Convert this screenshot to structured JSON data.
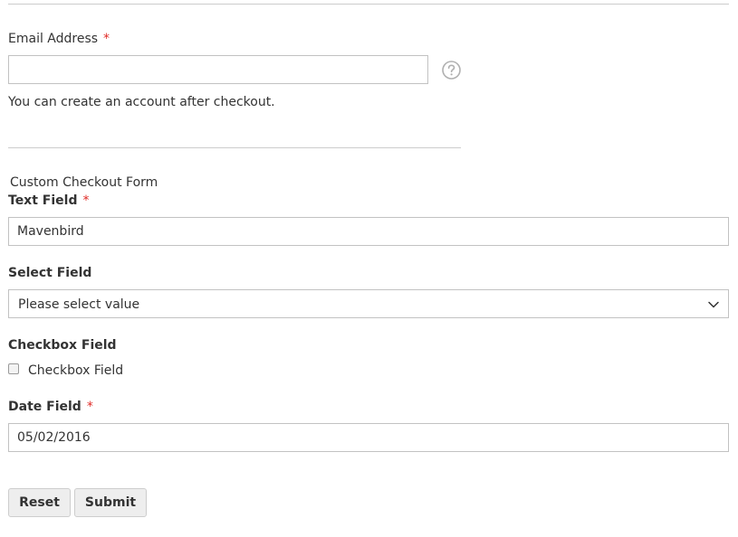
{
  "email": {
    "label": "Email Address",
    "required_mark": "*",
    "value": "",
    "help_icon": "question-circle-icon",
    "note": "You can create an account after checkout."
  },
  "custom_form": {
    "legend": "Custom Checkout Form",
    "text_field": {
      "label": "Text Field",
      "required_mark": "*",
      "value": "Mavenbird"
    },
    "select_field": {
      "label": "Select Field",
      "selected": "Please select value"
    },
    "checkbox_field": {
      "label": "Checkbox Field",
      "option_label": "Checkbox Field",
      "checked": false
    },
    "date_field": {
      "label": "Date Field",
      "required_mark": "*",
      "value": "05/02/2016"
    },
    "buttons": {
      "reset": "Reset",
      "submit": "Submit"
    }
  },
  "colors": {
    "required": "#e02b27",
    "border": "#c2c2c2",
    "button_bg": "#eeeeee",
    "text": "#333333"
  }
}
